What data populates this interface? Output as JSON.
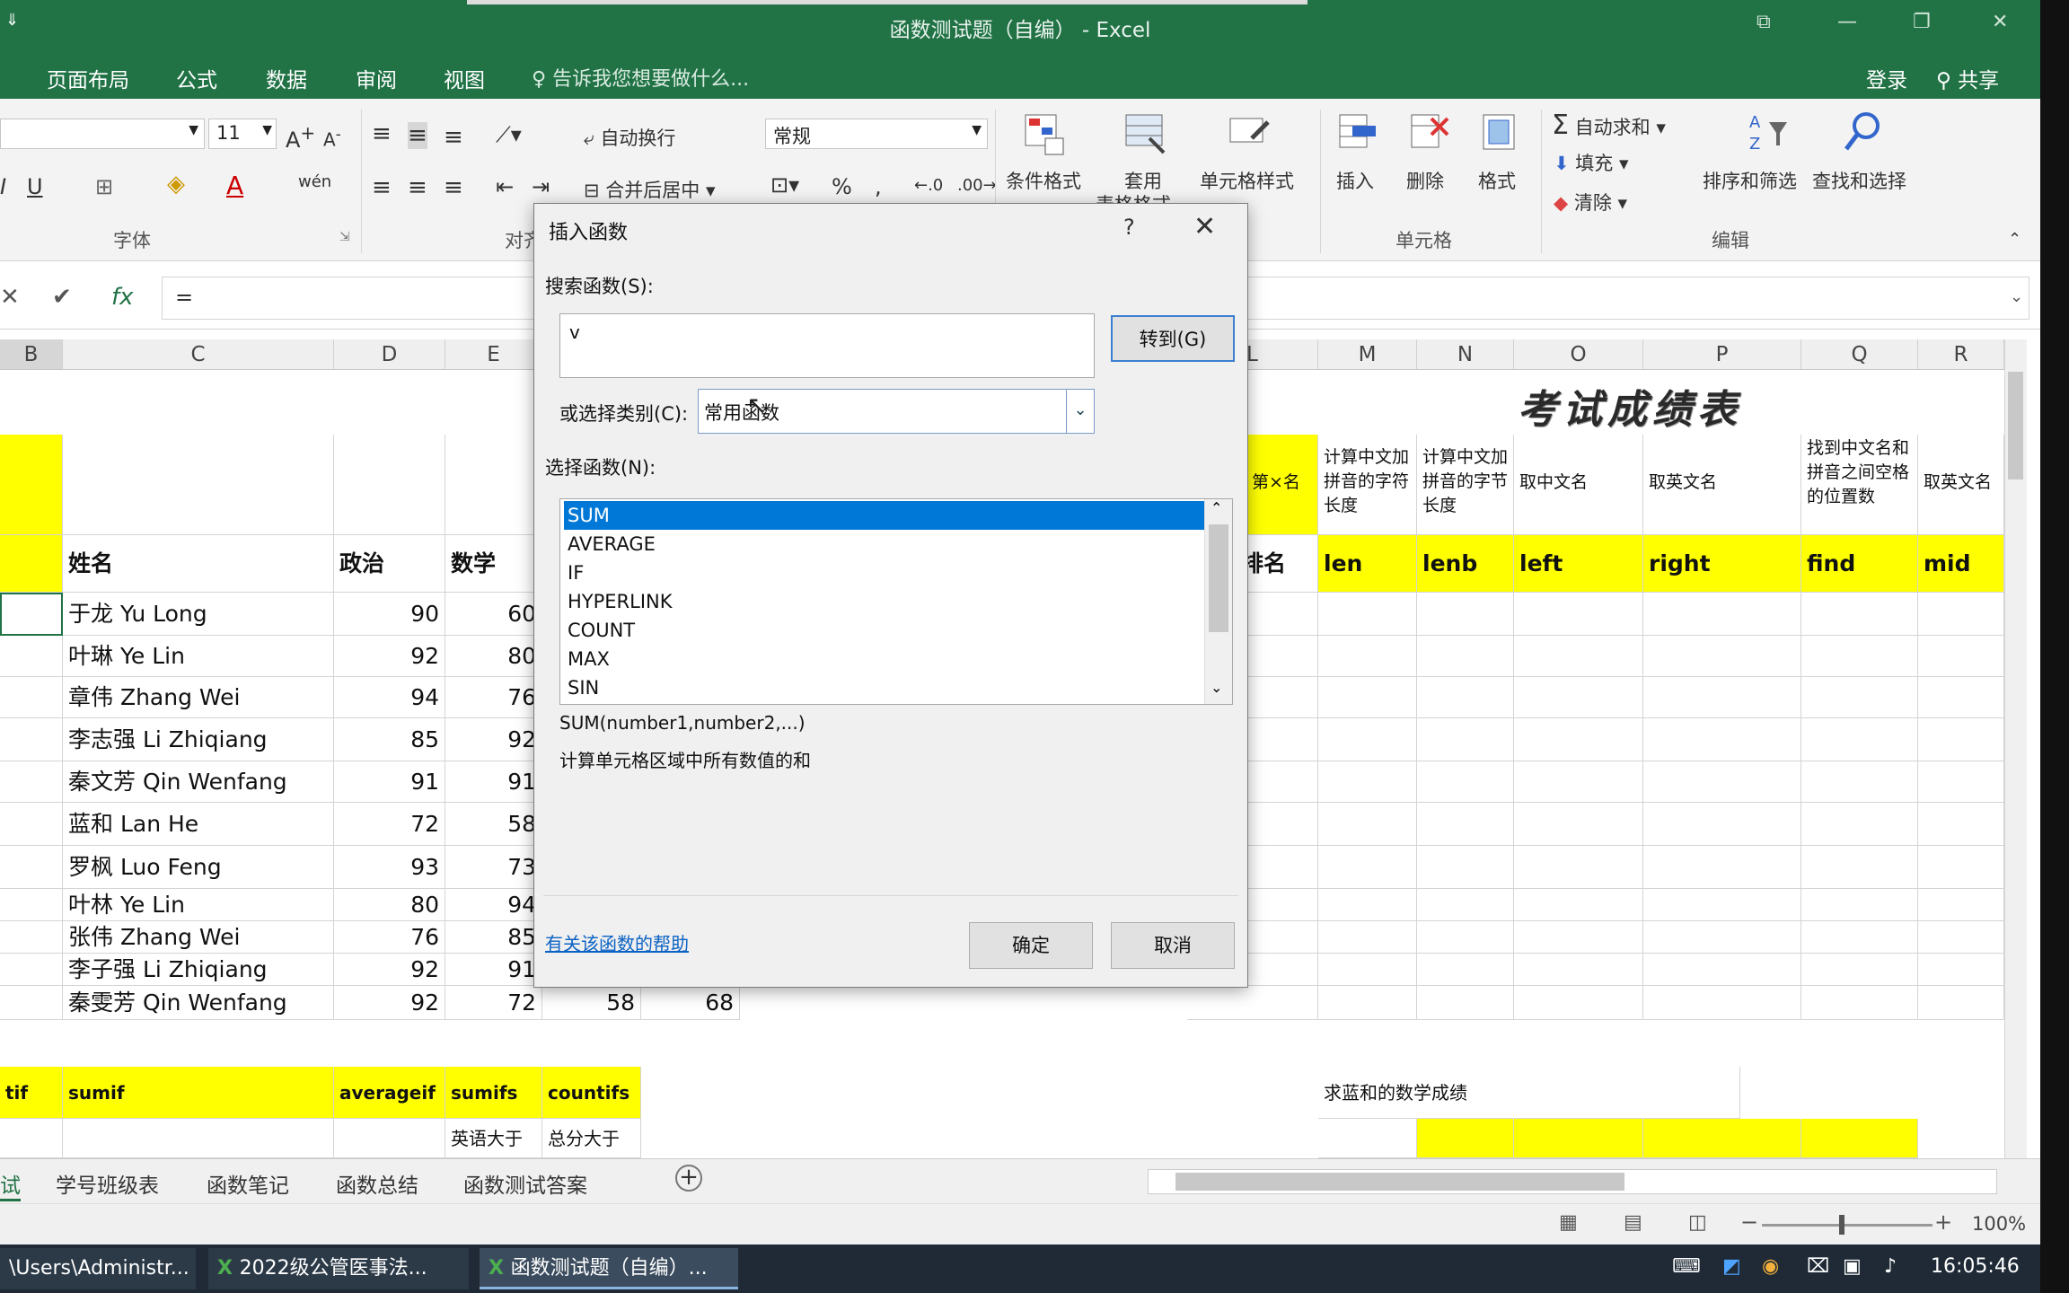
{
  "window": {
    "title": "函数测试题（自编） - Excel",
    "quick_access": "⇓",
    "controls": [
      "⧉",
      "—",
      "❐",
      "✕"
    ]
  },
  "menu": {
    "tabs": [
      "页面布局",
      "公式",
      "数据",
      "审阅",
      "视图"
    ],
    "tell_me": "告诉我您想要做什么...",
    "login": "登录",
    "share": "共享"
  },
  "ribbon": {
    "font_size": "11",
    "font_group": "字体",
    "align_group_partial": "对齐",
    "wrap_text": "自动换行",
    "merge_center": "合并后居中",
    "number_format": "常规",
    "cond_format": "条件格式",
    "table_format": "套用",
    "table_format2": "表格格式",
    "cell_style": "单元格样式",
    "insert": "插入",
    "delete": "删除",
    "format": "格式",
    "cells_group": "单元格",
    "autosum": "自动求和",
    "fill": "填充",
    "clear": "清除",
    "sort_filter": "排序和筛选",
    "find_select": "查找和选择",
    "edit_group": "编辑",
    "pinyin": "wén",
    "pct": "%",
    "comma": ","
  },
  "formula_bar": {
    "content": "="
  },
  "grid": {
    "columns": [
      {
        "label": "B"
      },
      {
        "label": "C"
      },
      {
        "label": "D"
      },
      {
        "label": "E"
      },
      {
        "label": "L"
      },
      {
        "label": "M"
      },
      {
        "label": "N"
      },
      {
        "label": "O"
      },
      {
        "label": "P"
      },
      {
        "label": "Q"
      },
      {
        "label": "R"
      }
    ],
    "sheet_title": "考试成绩表",
    "headers": {
      "name": "姓名",
      "politics": "政治",
      "math": "数学",
      "rank": "排名",
      "rank_top": "第×名",
      "len": "len",
      "lenb": "lenb",
      "left": "left",
      "right": "right",
      "find": "find",
      "mid": "mid",
      "desc_len": "计算中文加拼音的字符长度",
      "desc_lenb": "计算中文加拼音的字节长度",
      "desc_left": "取中文名",
      "desc_right": "取英文名",
      "desc_find": "找到中文名和拼音之间空格的位置数",
      "desc_mid": "取英文名"
    },
    "rows": [
      {
        "name": "于龙 Yu Long",
        "politics": "90",
        "math": "60"
      },
      {
        "name": "叶琳 Ye Lin",
        "politics": "92",
        "math": "80"
      },
      {
        "name": "章伟 Zhang Wei",
        "politics": "94",
        "math": "76"
      },
      {
        "name": "李志强 Li Zhiqiang",
        "politics": "85",
        "math": "92"
      },
      {
        "name": "秦文芳 Qin Wenfang",
        "politics": "91",
        "math": "91"
      },
      {
        "name": "蓝和 Lan He",
        "politics": "72",
        "math": "58"
      },
      {
        "name": "罗枫 Luo Feng",
        "politics": "93",
        "math": "73"
      },
      {
        "name": "叶林 Ye Lin",
        "politics": "80",
        "math": "94"
      },
      {
        "name": "张伟 Zhang Wei",
        "politics": "76",
        "math": "85"
      },
      {
        "name": "李子强 Li Zhiqiang",
        "politics": "92",
        "math": "91"
      },
      {
        "name": "秦雯芳 Qin Wenfang",
        "politics": "92",
        "math": "72",
        "extra1": "58",
        "extra2": "68"
      }
    ],
    "func_row": {
      "b": "tif",
      "c": "sumif",
      "d": "averageif",
      "e": "sumifs",
      "f": "countifs",
      "m": "求蓝和的数学成绩"
    },
    "last_row": {
      "e": "英语大于",
      "f": "总分大于"
    }
  },
  "sheets": {
    "tabs": [
      "试",
      "学号班级表",
      "函数笔记",
      "函数总结",
      "函数测试答案"
    ],
    "add": "+"
  },
  "status": {
    "zoom": "100%"
  },
  "taskbar": {
    "items": [
      "\\Users\\Administr...",
      "2022级公管医事法...",
      "函数测试题（自编）..."
    ],
    "time": "16:05:46"
  },
  "dialog": {
    "title": "插入函数",
    "help": "?",
    "close": "✕",
    "search_label": "搜索函数(S):",
    "search_value": "v",
    "goto_button": "转到(G)",
    "category_label": "或选择类别(C):",
    "category_value": "常用函数",
    "select_label": "选择函数(N):",
    "functions": [
      "SUM",
      "AVERAGE",
      "IF",
      "HYPERLINK",
      "COUNT",
      "MAX",
      "SIN"
    ],
    "syntax": "SUM(number1,number2,...)",
    "description": "计算单元格区域中所有数值的和",
    "help_link": "有关该函数的帮助",
    "ok": "确定",
    "cancel": "取消"
  }
}
